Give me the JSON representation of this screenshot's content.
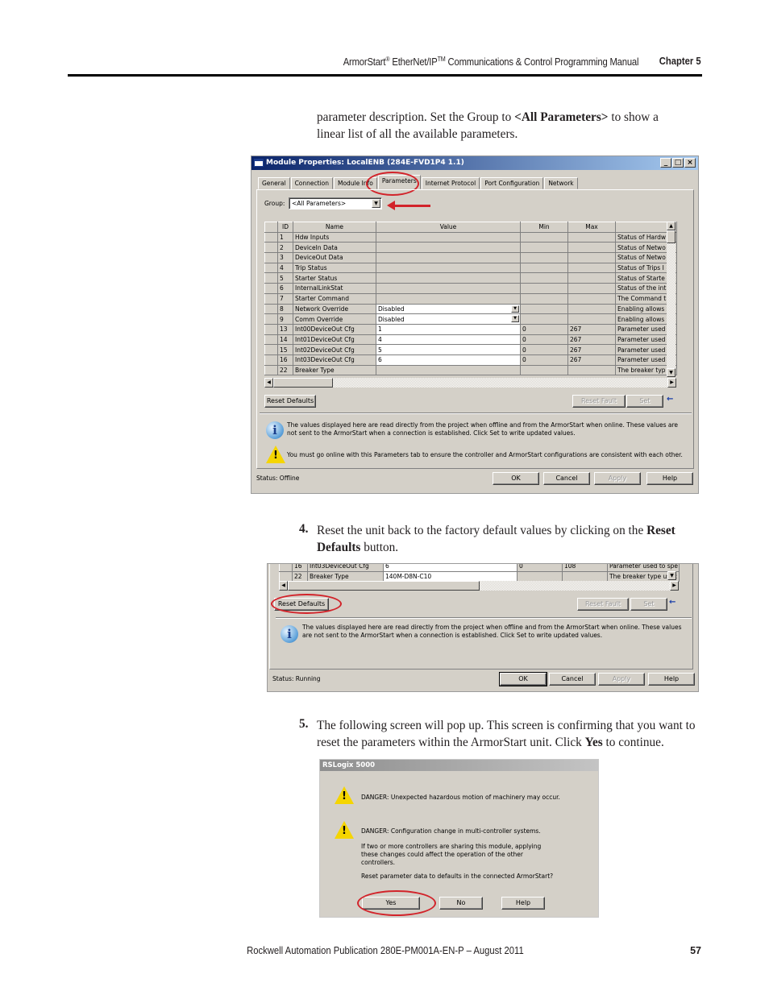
{
  "header": {
    "title_part1": "ArmorStart",
    "reg_mark": "®",
    "title_part2": " EtherNet/IP",
    "tm_mark": "TM",
    "title_part3": " Communications & Control Programming Manual",
    "chapter": "Chapter 5"
  },
  "intro": {
    "text_before": "parameter description. Set the Group to ",
    "bold": "<All Parameters>",
    "text_after": " to show a linear list of all the available parameters."
  },
  "dialog1": {
    "title": "Module Properties: LocalENB (284E-FVD1P4 1.1)",
    "window_buttons": [
      "_",
      "□",
      "×"
    ],
    "tabs": [
      "General",
      "Connection",
      "Module Info",
      "Parameters",
      "Internet Protocol",
      "Port Configuration",
      "Network"
    ],
    "active_tab": "Parameters",
    "group_label": "Group:",
    "group_value": "<All Parameters>",
    "columns": [
      "ID",
      "Name",
      "Value",
      "Min",
      "Max",
      ""
    ],
    "rows": [
      {
        "id": "1",
        "name": "Hdw Inputs",
        "value": "",
        "min": "",
        "max": "",
        "desc": "Status of Hardw"
      },
      {
        "id": "2",
        "name": "DeviceIn Data",
        "value": "",
        "min": "",
        "max": "",
        "desc": "Status of Netwo"
      },
      {
        "id": "3",
        "name": "DeviceOut Data",
        "value": "",
        "min": "",
        "max": "",
        "desc": "Status of Netwo"
      },
      {
        "id": "4",
        "name": "Trip Status",
        "value": "",
        "min": "",
        "max": "",
        "desc": "Status of Trips I"
      },
      {
        "id": "5",
        "name": "Starter Status",
        "value": "",
        "min": "",
        "max": "",
        "desc": "Status of Starte"
      },
      {
        "id": "6",
        "name": "InternalLinkStat",
        "value": "",
        "min": "",
        "max": "",
        "desc": "Status of the int"
      },
      {
        "id": "7",
        "name": "Starter Command",
        "value": "",
        "min": "",
        "max": "",
        "desc": "The Command t"
      },
      {
        "id": "8",
        "name": "Network Override",
        "value": "Disabled",
        "min": "",
        "max": "",
        "desc": "Enabling allows"
      },
      {
        "id": "9",
        "name": "Comm Override",
        "value": "Disabled",
        "min": "",
        "max": "",
        "desc": "Enabling allows"
      },
      {
        "id": "13",
        "name": "Int00DeviceOut Cfg",
        "value": "1",
        "min": "0",
        "max": "267",
        "desc": "Parameter used"
      },
      {
        "id": "14",
        "name": "Int01DeviceOut Cfg",
        "value": "4",
        "min": "0",
        "max": "267",
        "desc": "Parameter used"
      },
      {
        "id": "15",
        "name": "Int02DeviceOut Cfg",
        "value": "5",
        "min": "0",
        "max": "267",
        "desc": "Parameter used"
      },
      {
        "id": "16",
        "name": "Int03DeviceOut Cfg",
        "value": "6",
        "min": "0",
        "max": "267",
        "desc": "Parameter used"
      },
      {
        "id": "22",
        "name": "Breaker Type",
        "value": "",
        "min": "",
        "max": "",
        "desc": "The breaker typ"
      }
    ],
    "reset_defaults": "Reset Defaults",
    "reset_fault": "Reset Fault",
    "set": "Set",
    "info_msg": "The values displayed here are read directly from the project when offline and from the ArmorStart when online. These values are not sent to the ArmorStart when a connection is established.  Click Set to write updated values.",
    "warn_msg": "You must go online with this Parameters tab to ensure the controller and ArmorStart configurations are consistent with each other.",
    "status": "Status:  Offline",
    "ok": "OK",
    "cancel": "Cancel",
    "apply": "Apply",
    "help": "Help"
  },
  "step4": {
    "num": "4.",
    "text_before": "Reset the unit back to the factory default values by clicking on the ",
    "bold": "Reset Defaults",
    "text_after": " button."
  },
  "dialog2": {
    "rows": [
      {
        "id": "16",
        "name": "Int03DeviceOut Cfg",
        "value": "6",
        "min": "0",
        "max": "108",
        "desc": "Parameter used to spe"
      },
      {
        "id": "22",
        "name": "Breaker Type",
        "value": "140M-D8N-C10",
        "min": "",
        "max": "",
        "desc": "The breaker type usec"
      }
    ],
    "reset_defaults": "Reset Defaults",
    "reset_fault": "Reset Fault",
    "set": "Set",
    "info_msg": "The values displayed here are read directly from the project when offline and from the ArmorStart when online. These values are not sent to the ArmorStart when a connection is established.  Click Set to write updated values.",
    "status": "Status:  Running",
    "ok": "OK",
    "cancel": "Cancel",
    "apply": "Apply",
    "help": "Help"
  },
  "step5": {
    "num": "5.",
    "text_before": "The following screen will pop up. This screen is confirming that you want to reset the parameters within the ArmorStart unit. Click ",
    "bold": "Yes",
    "text_after": " to continue."
  },
  "dialog3": {
    "title": "RSLogix 5000",
    "danger1": "DANGER:  Unexpected hazardous motion of machinery may occur.",
    "danger2": "DANGER:  Configuration change in multi-controller systems.",
    "detail": "If two or more controllers are sharing this module, applying these changes could affect the operation of the other controllers.",
    "question": "Reset parameter data to defaults in the connected ArmorStart?",
    "yes": "Yes",
    "no": "No",
    "help": "Help"
  },
  "footer": {
    "publication": "Rockwell Automation Publication 280E-PM001A-EN-P – August 2011",
    "page": "57"
  },
  "colors": {
    "annotation_red": "#d2232a",
    "window_face": "#d4d0c8",
    "titlebar_start": "#0a246a",
    "titlebar_end": "#a6caf0"
  }
}
